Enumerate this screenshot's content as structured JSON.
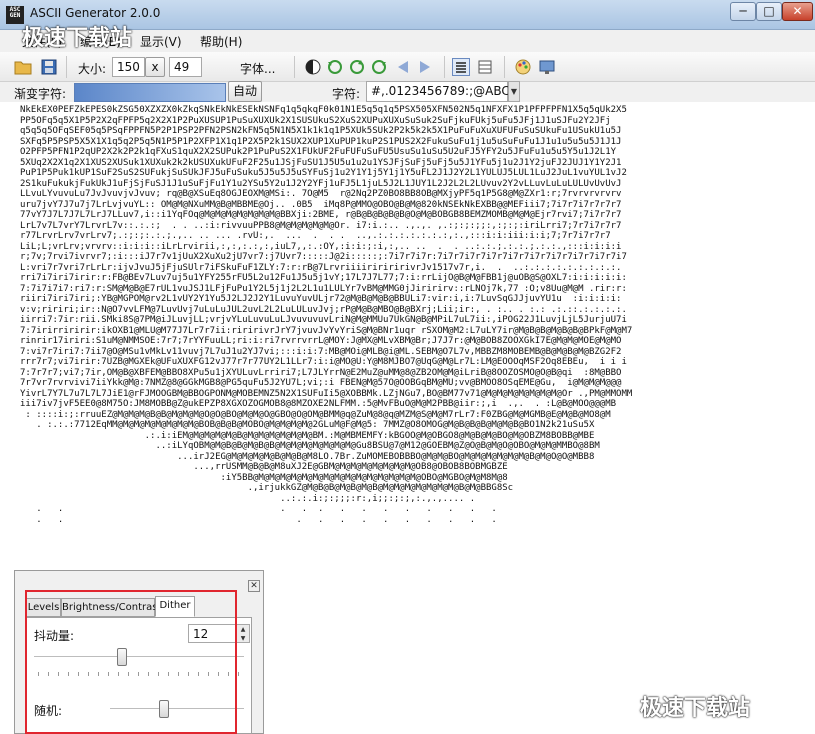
{
  "window": {
    "title": "ASCII Generator 2.0.0",
    "controls": {
      "minimize": "─",
      "maximize": "□",
      "close": "✕"
    }
  },
  "app_icon": {
    "line1": "ASC",
    "line2": "GEN"
  },
  "menu": [
    {
      "label": "文件(F)"
    },
    {
      "label": "编辑(E)"
    },
    {
      "label": "显示(V)"
    },
    {
      "label": "帮助(H)"
    }
  ],
  "toolbar": {
    "size_label": "大小:",
    "width_value": "150",
    "x_label": "x",
    "height_value": "49",
    "font_button": "字体...",
    "icons": [
      "open-folder-icon",
      "save-disk-icon",
      "contrast-icon",
      "rotate-ccw-icon",
      "refresh-icon",
      "rotate-cw-icon",
      "flip-horizontal-icon",
      "flip-vertical-icon",
      "text-view-icon",
      "grid-view-icon",
      "color-palette-icon",
      "monitor-icon"
    ]
  },
  "toolbar2": {
    "ramp_label": "渐变字符:",
    "ramp_value": "",
    "auto_button": "自动",
    "chars_label": "字符:",
    "chars_value": "#,.0123456789:;@ABCI"
  },
  "ascii_output": [
    "NkEkEX0PEFZkEPES0kZSG50XZXZX0kZkqSNkEkNkESEkNSNFq1q5qkqF0k01N1E5q5q1q5PSX505XFN502N5q1NFXFX1P1PFPFPFN1X5q5qUk2X5",
    "PP5OFq5q5X1P5P2X2qFPFP5q2X2X1P2PuXUSUP1PuSuXUXUk2X1SUSUkuS2XuS2XUPuXUXuSuSuk2SuFjkuFUkj5uFu5JFj1J1uSJFu2Y2JFj",
    "q5q5q5OFqSEF05q5PSqFPPFN5P2P1PSP2PFN2PSN2kFN5q5N1N5X1k1k1q1P5XUk5SUk2P2k5k2k5X1PuFuFuXuXUFUFuSuSUkuFu1USukU1u5J",
    "SXFq5P5PSP5X5X1X1q5q2P5q5N1P5P1P2XFP1X1q1P2X5P2k1SUX2XUP1XuPUP1kuP2S1PUS2X2FukuSuFu1j1u5uSuFuFu1J1u1u5u5u5J1J1J",
    "O2PFP5PFN1P2qUP2X2k2P2k1qFXuS1quX2X2SUPuk2P1PuPuS2X1FUkUF2FuFUFuSuFU5UsuSu1uSu5U2uFJ5YFY2u5JFuFu1u5u5Y5u1J2L1Y",
    "5XUq2X2X1q2X1XUS2XUSuk1XUXuk2k2kUSUXukUFuF2F25u1JSjFuSU1J5U5u1u2u1YSJFjSuFj5uFj5u5J1YFu5j1u2J1Y2juFJ2JUJ1Y1Y2J1",
    "PuP1P5Puk1kUP1SuF2SuS2SUFukjSuSUkJFJ5uFuSuku5J5u5J5uSYFuSj1u2Y1Y1j5Y1j1Y5uFL2J1J2Y2L1YULUJ5LUL1LuJ2JuL1vuYUL1vJ2",
    "2S1kuFukukjFukUkJ1uFjSjFuSJ1J1uSuFjFu1Y1u2YSu5Y2u1J2Y2YFj1uFJ5L1juL5J2L1JUY1L2J2L2L2LUvuv2Y2vLLuvLuLuLULUvUvUvJ",
    "LLvuLYvuvuLu7JvJvuvjvJvuv; rq@B@XSuEq8OGJEOXM@MSi:. 7O@M5  r@2Nq2PZ0BO8BB8OB@MXjyPF5q1P5G8@M@ZXr1:r;7rvrvrvrvrv",
    "uru7jvY7J7u7j7LrLvjvuYL:: OM@M@NXuMM@B@MBBME@Oj.. .0B5  iMq8P@MMO@OBO@B@M@820kNSEkNkEXBB@@MEFiii7;7i7r7i7r7r7r7",
    "77vY7J7L7J7L7LrJ7LLuv7,i::i1YqFOq@M@M@M@M@M@M@M@BBXji:2BME, r@B@B@B@B@B@O@M@BOBGB8BEMZMOMB@M@M@Ejr7rvi7;7i7r7r7",
    "LrL7v7L7vrY7LrvrL7v::.:.:;  . . ..:i:rivvuuPPB8@M@M@M@M@M@Or. i7:i.:.. .,.,. ,.:;:;:;;:,:;:;:iriLrri7;7r7i7r7r7",
    "r77LrvrLrv7vrLrv7;.:;:;:.:.;.,.. .. ... .rvU:,.  ...  .  . .  ..,.:.:.:.:.:.:.:,:.,:::i:i:iii:i:i;7;7r7i7r7r7",
    "LiL;L;vrLrv;vrvrv::i:i:i::iLrLrvirii,:,:,:.:,:,iuL7,,:.:OY,:i:i:;:i,:,.. ..  .  . ..:.:.;.:.:.;.:.:.,:::i:i:i:i",
    "r;7v;7rvi7ivrvr7;:i:::iJ7r7v1jUuX2XuXu2jU7vr7:j7Uvr7:::::J@2i:::::;:7i7r7i7r:7i7r7i7r7i7r7i7r7i7r7i7r7i7r7i7r7i7",
    "L:vri7r7vri7rLrLr:ijvJvuJ5jFjuSUlr7iFSkuFuF1ZLY:7:r:rB@7LrvriiiiririririvrJv1517v7r,i.  .  ..:.:.:.:.:.:.:.:.:.",
    "rri7i7iri7irir:r:FB@BEv7Luv7uj5u1YFY255rFU5L2u12Fu1J5u5j1vY;17L7J7L77;7:i:rrLijO@B@M@FBB1j@uOB@S@OXL7:i:i:i:i:i:",
    "7:7i7i7i7:ri7:r:SM@M@B@E7rUL1vuJSJ1LFjFuPu1Y2L5j1j2L2L1u1LULYr7vBM@MMG0jJiririrv::rLNOj7k,77 :O;v8Uu@M@M .rir:r:",
    "riiri7iri7iri;:YB@MGPOM@rv2L1vUY2Y1Yu5J2LJ2J2Y1LuvuYuvULjr72@M@B@M@B@BBULi7:vir:i,i:7LuvSqGJJjuvYU1u  :i:i:i:i:",
    "v:v;ririri;ir::N@O7vvLFM@7LuvUvj7uLuLuJUL2uvL2L2LuLULuvJvj;rP@M@B@MBO@B@BXrj;Lii;ir:, . :.. . :.: .:.::.:.:.:.:.",
    "iirri7:7ir:rii.SMki8S@7PM@iJLuvjLL;vrjvYLuLuvuLuLJvuvuvuvLriN@M@MMUu7UkGN@B@MPiL7uL7ii:,iPOG22J1LuvjLjL5JurjuU7i",
    "7:7irirriririr:ikOXB1@MLU@M77J7Lr7r7ii:riririvrJrY7jvuvJvYvYriS@M@BNr1uqr rSXOM@M2:L7uLY7ir@M@B@B@M@B@B@BPkF@M@M7",
    "rinrir17iriri:S1uM@NMMSOE:7r7;7rYYFuuLL;ri:i:ri7rvrrvrrL@MOY:J@MX@MLvXBM@Br;J7J7r:@M@BOB8ZOOXGkI7E@M@M@MOE@M@MO",
    "7:vi7r7iri7:7ii7@O@MSu1vMkLv11vuvj7L7uJ1u2YJ7vi;:::i:i:7:MB@MOi@MLB@i@ML.SEBM@O7L7v,MBBZM8MOBEMB@B@M@B@M@BZG2F2",
    "rrr7r7;vi7irir:7UZB@MGXEk@UFuXUXFG12vJ77r7r77UY2L1LLr7:i:i@MO@U:Y@M8MJBO7@UqG@M@Lr7L:LM@EOOOqMSF2Oq8EBEu,  i i i",
    "7:7r7r7;vi7;7ir,OM@B@XBFEM@BBO8XPu5u1jXYULuvLrriri7;L7JLYrrN@E2MuZ@uMM@8@ZB2OM@M@iLriB@8OOZOSMO@O@B@qi  :8M@BBO",
    "7r7vr7rvrvivi7iiYkk@M@:7NMZ@8@GGkMGB8@PG5quFu5J2YU7L;vi;:i FBEN@M@57O@OOBGqBM@MU;vv@BMOO8OSqEME@Gu,  i@M@M@M@@@",
    "YivrL7Y7L7u7L7L7JiE1@rFJMOOGBM@BBOGPONM@MOBEMNZ5N2X1SUFuIi5@XOBBMk.LZjNGu7,BO@BM77v71@M@M@M@M@M@M@M@Or .,PM@MMOMM",
    "iii7iv7jvF5EE0@8M75O:JM8MOBB@Z@ukEPZP8XGXOZOGMOB8@8MZOXE2NLFMM.:5@MvFBuO@M@M2PBB@iir:;,i  .,.  . :L@B@MOO@@@MB",
    " : ::::i:;:rruuEZ@M@M@M@B@B@M@M@M@O@O@BO@M@M@O@GBO@O@OM@BMM@q@ZuM@8@q@MZM@S@M@M7rLr7:F0ZBG@M@MGMB@E@M@B@MO8@M",
    "   . :.:.:7712EqMM@M@M@M@M@M@M@M@BOB@B@B@MOBO@M@M@M@M@2GLuM@F@M@5: 7MMZ@O8OMOG@M@B@B@B@M@M@B@BO1N2k21uSu5X",
    "                       .:.i:iEM@M@M@M@M@B@M@M@M@M@M@M@BM.:M@MBMEMFY:kBGOO@M@OBGO8@M@B@M@BO@M@OBZM8BOBB@MBE",
    "                         ..:iLYqOBM@M@B@B@M@B@B@M@M@M@M@M@M@M@Gu8BSU@7@M12@GOEBM@Z@O@B@M@O@OBO@M@M@MMBO@8BM",
    "                             ...irJ2EG@M@M@M@M@B@M@B@M8LO.7Br.ZuMOMEBOBBBO@M@M@BO@M@M@M@M@M@M@B@M@O@O@MBB8",
    "                                ...,rrUSMM@B@B@M8uXJ2E@GBM@M@M@M@M@M@M@M@OB8@OBOB8BOBMGBZE",
    "                                     :iY5BB@M@M@M@M@M@M@M@M@M@M@M@M@M@M@M@OBO@MGBO@M@M8M@8",
    "                                          .,irjukkGZ@M@B@B@M@B@M@B@M@M@M@M@M@M@M@B@M@BBG8Sc",
    "                                                ..:.:.i:;:;;;:r:,i;;:;:;,:.,.,.... .",
    "   .   .                                        .   .  .   .   .   .   .   .   .   .   .  ",
    "   .   .                                           .   .   .   .   .   .   .   .   .   .  "
  ],
  "panel": {
    "tabs": [
      {
        "label": "Levels"
      },
      {
        "label": "Brightness/Contrast"
      },
      {
        "label": "Dither"
      }
    ],
    "active_tab": "Dither",
    "dither_label": "抖动量:",
    "dither_value": "12",
    "dither_level": 0.42,
    "random_label": "随机:",
    "random_level": 0.4
  },
  "watermark": {
    "text": "极速下载站"
  }
}
